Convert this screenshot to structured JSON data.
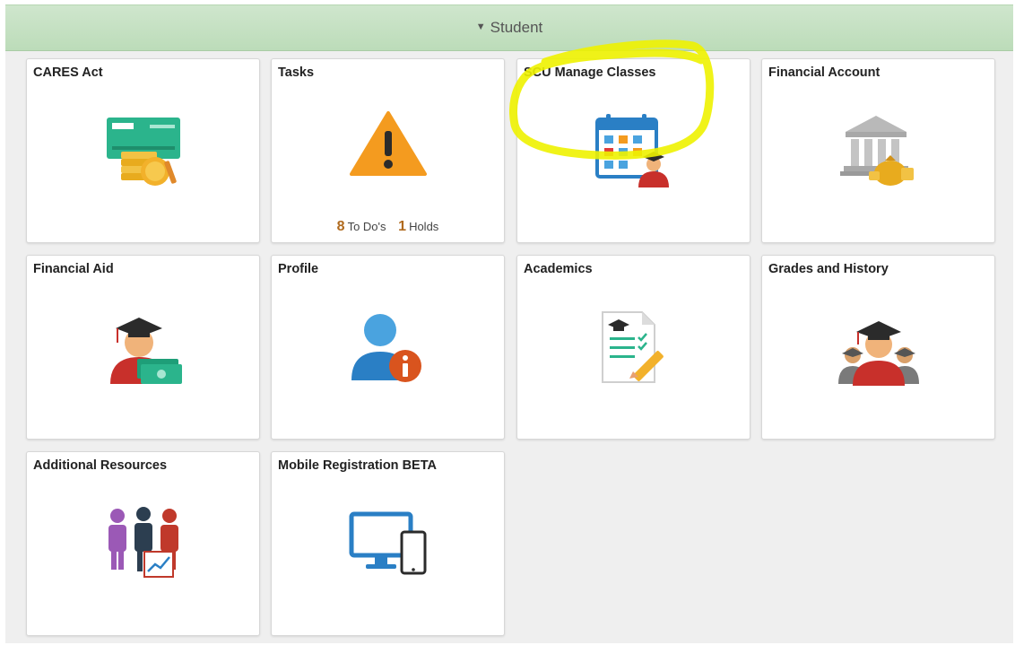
{
  "header": {
    "title": "Student",
    "caret_icon": "caret-down-icon"
  },
  "tiles": [
    {
      "title": "CARES Act",
      "icon": "check-coins-icon"
    },
    {
      "title": "Tasks",
      "icon": "warning-icon"
    },
    {
      "title": "SCU Manage Classes",
      "icon": "calendar-student-icon"
    },
    {
      "title": "Financial Account",
      "icon": "bank-icon"
    },
    {
      "title": "Financial Aid",
      "icon": "graduate-money-icon"
    },
    {
      "title": "Profile",
      "icon": "user-info-icon"
    },
    {
      "title": "Academics",
      "icon": "document-checklist-icon"
    },
    {
      "title": "Grades and History",
      "icon": "graduates-icon"
    },
    {
      "title": "Additional Resources",
      "icon": "people-chart-icon"
    },
    {
      "title": "Mobile Registration BETA",
      "icon": "monitor-phone-icon"
    }
  ],
  "tasks": {
    "todo_count": "8",
    "todo_label": "To Do's",
    "holds_count": "1",
    "holds_label": "Holds"
  },
  "colors": {
    "header_green": "#c6e2c3",
    "highlight_yellow": "#eef200",
    "task_number": "#b06a1e"
  }
}
